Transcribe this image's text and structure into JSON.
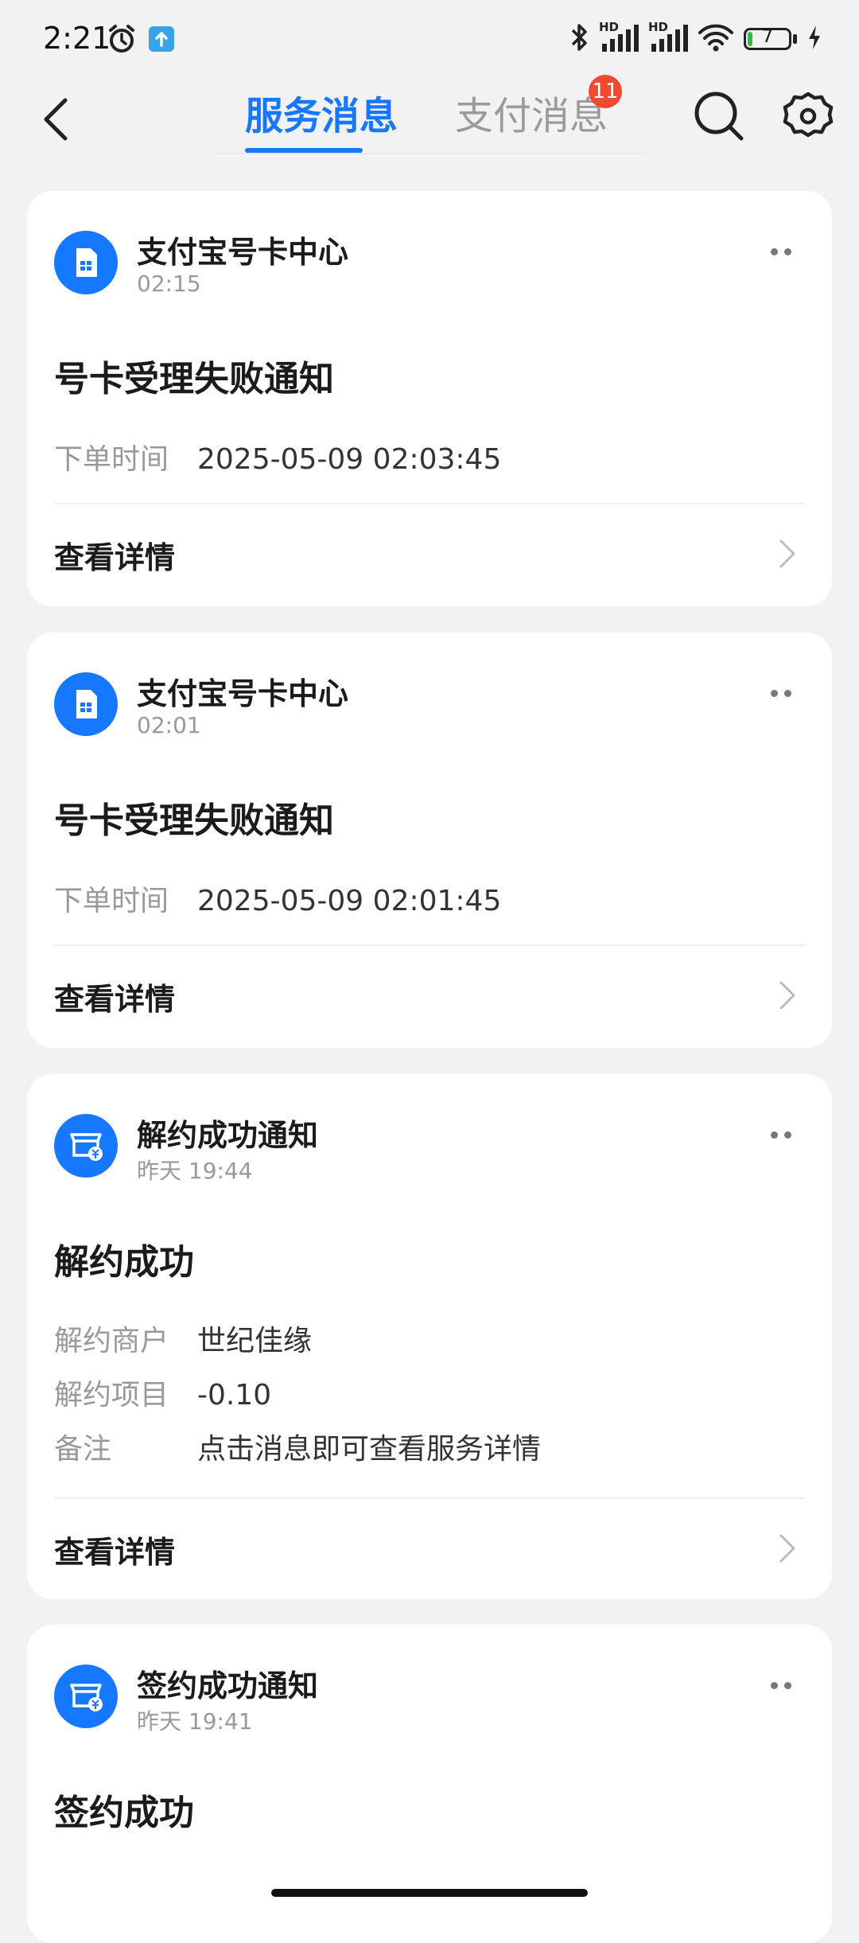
{
  "status_bar": {
    "time": "2:21",
    "battery": "7",
    "icons": [
      "alarm-icon",
      "upload-icon",
      "bluetooth-icon",
      "signal-hd-icon",
      "signal-hd-icon",
      "wifi-icon",
      "battery-icon",
      "charging-icon"
    ],
    "hd1": "HD",
    "hd2": "HD"
  },
  "header": {
    "tabs": [
      {
        "label": "服务消息",
        "active": true
      },
      {
        "label": "支付消息",
        "active": false,
        "badge": "11"
      }
    ],
    "accent_color": "#1677ff",
    "badge_color": "#f04a33"
  },
  "cards": [
    {
      "sender": "支付宝号卡中心",
      "time": "02:15",
      "title": "号卡受理失败通知",
      "fields": [
        {
          "key": "下单时间",
          "value": "2025-05-09 02:03:45"
        }
      ],
      "action": "查看详情"
    },
    {
      "sender": "支付宝号卡中心",
      "time": "02:01",
      "title": "号卡受理失败通知",
      "fields": [
        {
          "key": "下单时间",
          "value": "2025-05-09 02:01:45"
        }
      ],
      "action": "查看详情"
    },
    {
      "sender": "解约成功通知",
      "time": "昨天 19:44",
      "title": "解约成功",
      "fields": [
        {
          "key": "解约商户",
          "value": "世纪佳缘"
        },
        {
          "key": "解约项目",
          "value": "-0.10"
        },
        {
          "key": "备注",
          "value": "点击消息即可查看服务详情"
        }
      ],
      "action": "查看详情"
    },
    {
      "sender": "签约成功通知",
      "time": "昨天 19:41",
      "title": "签约成功"
    }
  ]
}
